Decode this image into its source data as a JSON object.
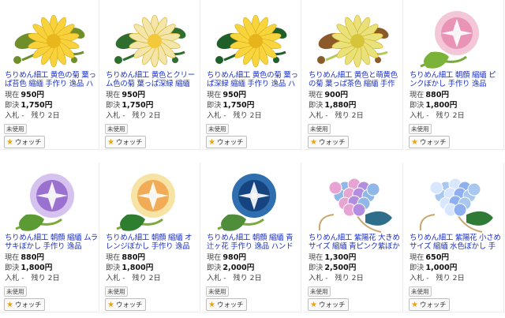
{
  "labels": {
    "current": "現在",
    "buy_now": "即決",
    "bids_prefix": "入札 -",
    "remaining": "残り 2日",
    "unused": "未使用",
    "watch": "ウォッチ"
  },
  "items": [
    {
      "title": "ちりめん細工 黄色の菊 葉っぱ苔色 縮緬 手作り 逸品 ハ",
      "current": "950円",
      "buy_now": "1,750円",
      "thumb": "chrysanthemum-yellow"
    },
    {
      "title": "ちりめん細工 黄色とクリーム色の菊 葉っぱ深緑 縮緬",
      "current": "950円",
      "buy_now": "1,750円",
      "thumb": "chrysanthemum-cream"
    },
    {
      "title": "ちりめん細工 黄色の菊 葉っぱ深緑 縮緬 手作り 逸品 ハ",
      "current": "950円",
      "buy_now": "1,750円",
      "thumb": "chrysanthemum-yellow-dark"
    },
    {
      "title": "ちりめん細工 黄色と萌黄色の菊 葉っぱ茶色 縮緬 手作",
      "current": "900円",
      "buy_now": "1,880円",
      "thumb": "chrysanthemum-moegi"
    },
    {
      "title": "ちりめん細工 朝顔 縮緬 ピンクぼかし 手作り 逸品",
      "current": "880円",
      "buy_now": "1,800円",
      "thumb": "morning-glory-pink"
    },
    {
      "title": "ちりめん細工 朝顔 縮緬 ムラサキぼかし 手作り 逸品",
      "current": "880円",
      "buy_now": "1,800円",
      "thumb": "morning-glory-purple"
    },
    {
      "title": "ちりめん細工 朝顔 縮緬 オレンジぼかし 手作り 逸品",
      "current": "880円",
      "buy_now": "1,800円",
      "thumb": "morning-glory-orange"
    },
    {
      "title": "ちりめん細工 朝顔 縮緬 青 辻ヶ花 手作り 逸品 ハンド",
      "current": "980円",
      "buy_now": "2,000円",
      "thumb": "morning-glory-blue"
    },
    {
      "title": "ちりめん細工 紫陽花 大きめサイズ 縮緬 青ピンク紫ぼか",
      "current": "1,300円",
      "buy_now": "2,500円",
      "thumb": "hydrangea-large"
    },
    {
      "title": "ちりめん細工 紫陽花 小さめサイズ 縮緬 水色ぼかし 手",
      "current": "650円",
      "buy_now": "1,000円",
      "thumb": "hydrangea-small"
    }
  ],
  "colors": {
    "link": "#1b30c6",
    "star": "#f3a300",
    "yellow_petal": "#f7d23a",
    "cream_petal": "#f3e6a8",
    "leaf_green": "#3d8a2e",
    "moss_green": "#6aa334",
    "hydrangea_blue": "#8fb7e8",
    "hydrangea_pink": "#e7a3d1"
  }
}
